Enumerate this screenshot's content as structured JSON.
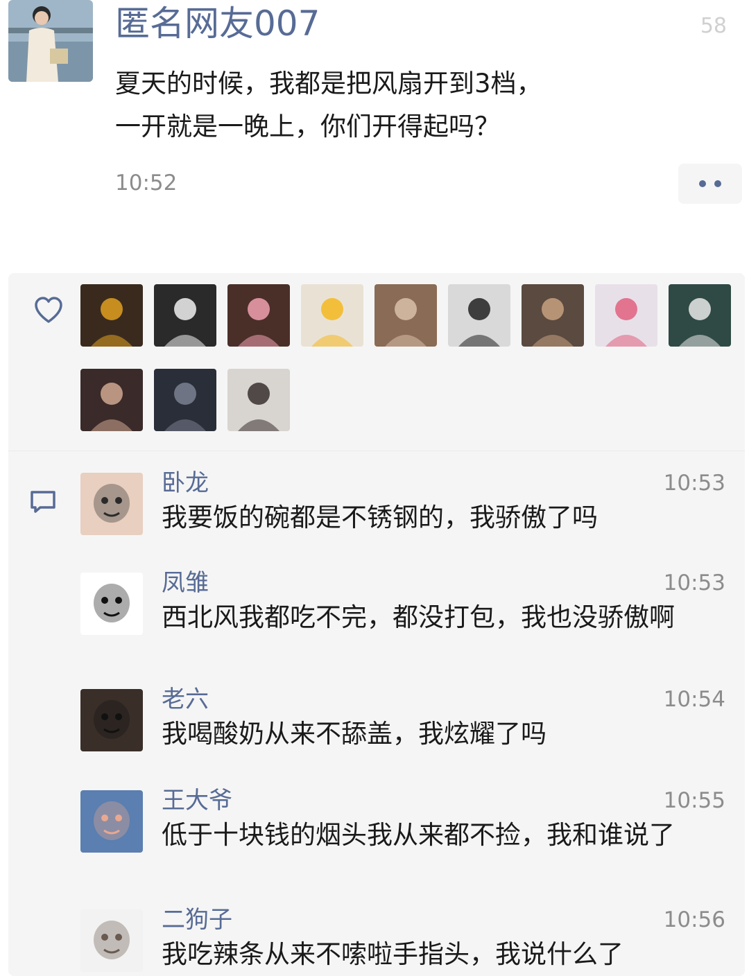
{
  "post": {
    "username": "匿名网友007",
    "text_line1": "夏天的时候，我都是把风扇开到3档，",
    "text_line2": "一开就是一晚上，你们开得起吗？",
    "time": "10:52",
    "corner_mark": "58"
  },
  "likes": {
    "icon": "heart-icon",
    "avatars": [
      {
        "color": "#3a2a1e",
        "accent": "#e0a020"
      },
      {
        "color": "#2a2a2a",
        "accent": "#f0f0f0"
      },
      {
        "color": "#4a2f28",
        "accent": "#f0a0b0"
      },
      {
        "color": "#e9e2d4",
        "accent": "#f5b820"
      },
      {
        "color": "#8a6b55",
        "accent": "#d8c0a8"
      },
      {
        "color": "#d9d9d9",
        "accent": "#222222"
      },
      {
        "color": "#5a4a40",
        "accent": "#c8a080"
      },
      {
        "color": "#e8e0e8",
        "accent": "#e06080"
      },
      {
        "color": "#2f4a44",
        "accent": "#e8e8e8"
      },
      {
        "color": "#3a2a2a",
        "accent": "#d0a890"
      },
      {
        "color": "#2a2e38",
        "accent": "#7a8090"
      },
      {
        "color": "#d8d4d0",
        "accent": "#3a3030"
      }
    ]
  },
  "comments_icon": "comment-icon",
  "comments": [
    {
      "name": "卧龙",
      "time": "10:53",
      "text": "我要饭的碗都是不锈钢的，我骄傲了吗",
      "avatar_color": "#e8cfc0",
      "avatar_accent": "#2a2a2a"
    },
    {
      "name": "凤雏",
      "time": "10:53",
      "text": "西北风我都吃不完，都没打包，我也没骄傲啊",
      "avatar_color": "#ffffff",
      "avatar_accent": "#111111"
    },
    {
      "name": "老六",
      "time": "10:54",
      "text": "我喝酸奶从来不舔盖，我炫耀了吗",
      "avatar_color": "#3a2e28",
      "avatar_accent": "#111111"
    },
    {
      "name": "王大爷",
      "time": "10:55",
      "text": "低于十块钱的烟头我从来都不捡，我和谁说了",
      "avatar_color": "#5a7fb0",
      "avatar_accent": "#e8a890"
    },
    {
      "name": "二狗子",
      "time": "10:56",
      "text": "我吃辣条从来不嗦啦手指头，我说什么了",
      "avatar_color": "#f2f2f2",
      "avatar_accent": "#6a5a50"
    }
  ]
}
